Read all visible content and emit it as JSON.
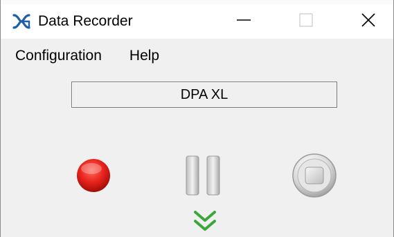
{
  "window": {
    "title": "Data Recorder",
    "icon": "data-recorder-app-icon",
    "controls": [
      "minimize-icon",
      "maximize-icon",
      "close-icon"
    ]
  },
  "menu": {
    "items": [
      {
        "label": "Configuration"
      },
      {
        "label": "Help"
      }
    ]
  },
  "device": {
    "name": "DPA XL"
  },
  "controls": {
    "record": {
      "icon": "record-icon",
      "color": "#e8231c",
      "state": "enabled"
    },
    "pause": {
      "icon": "pause-icon",
      "state": "disabled"
    },
    "stop": {
      "icon": "stop-icon",
      "state": "disabled"
    },
    "expand": {
      "icon": "double-chevron-down-icon",
      "color": "#3aa73a"
    }
  }
}
